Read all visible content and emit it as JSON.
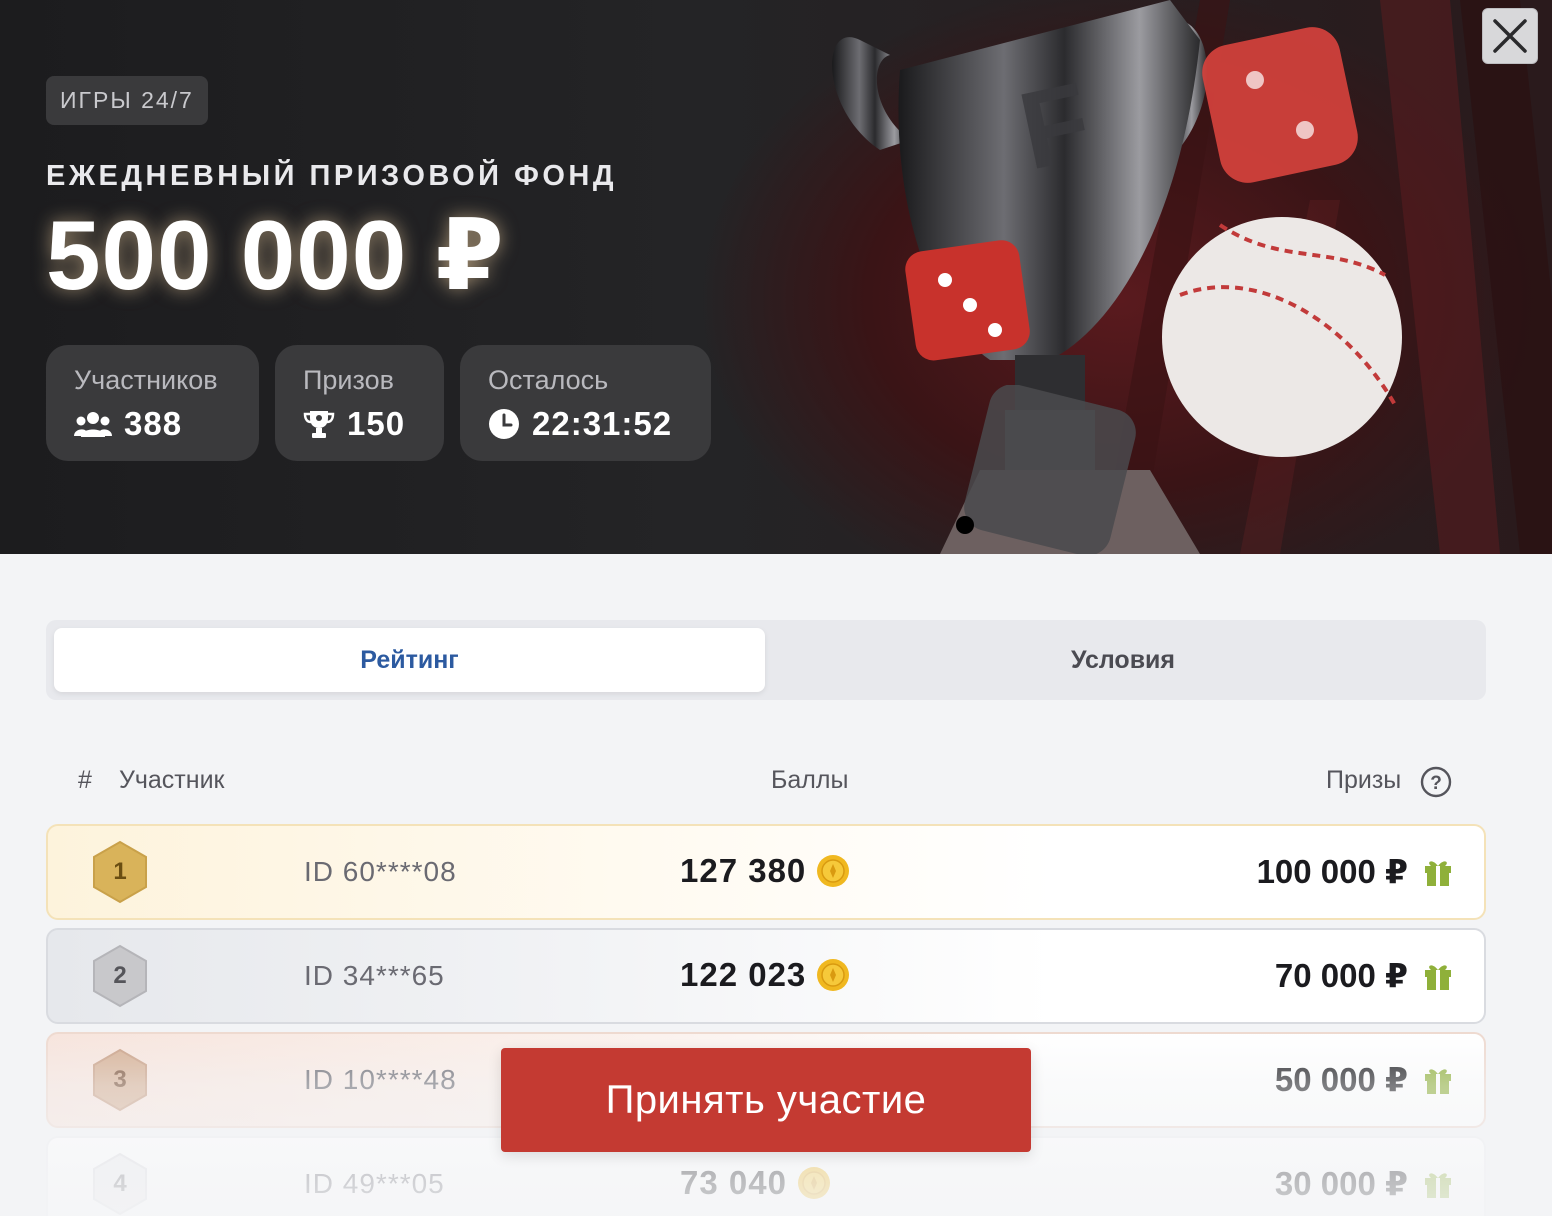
{
  "hero": {
    "tag": "ИГРЫ 24/7",
    "subtitle": "ЕЖЕДНЕВНЫЙ ПРИЗОВОЙ ФОНД",
    "amount": "500 000 ₽",
    "stats": [
      {
        "label": "Участников",
        "value": "388",
        "icon": "users-icon"
      },
      {
        "label": "Призов",
        "value": "150",
        "icon": "trophy-icon"
      },
      {
        "label": "Осталось",
        "value": "22:31:52",
        "icon": "clock-icon"
      }
    ],
    "close_icon": "close-icon"
  },
  "tabs": {
    "rating": "Рейтинг",
    "conditions": "Условия"
  },
  "table": {
    "headers": {
      "rank": "#",
      "participant": "Участник",
      "points": "Баллы",
      "prizes": "Призы"
    },
    "help_icon": "question-circle-icon",
    "rows": [
      {
        "rank": "1",
        "id": "ID 60****08",
        "points": "127 380",
        "prize": "100 000 ₽"
      },
      {
        "rank": "2",
        "id": "ID 34***65",
        "points": "122 023",
        "prize": "70 000 ₽"
      },
      {
        "rank": "3",
        "id": "ID 10****48",
        "points": "",
        "prize": "50 000 ₽"
      },
      {
        "rank": "4",
        "id": "ID 49***05",
        "points": "73 040",
        "prize": "30 000 ₽"
      }
    ]
  },
  "cta": {
    "label": "Принять участие"
  },
  "colors": {
    "accent": "#c43a32",
    "tab_active": "#2c5aa0",
    "gold": "#d9b35a",
    "silver": "#b8b8bc",
    "bronze": "#d6b196",
    "gift": "#8fb03a",
    "coin": "#f0b820"
  }
}
